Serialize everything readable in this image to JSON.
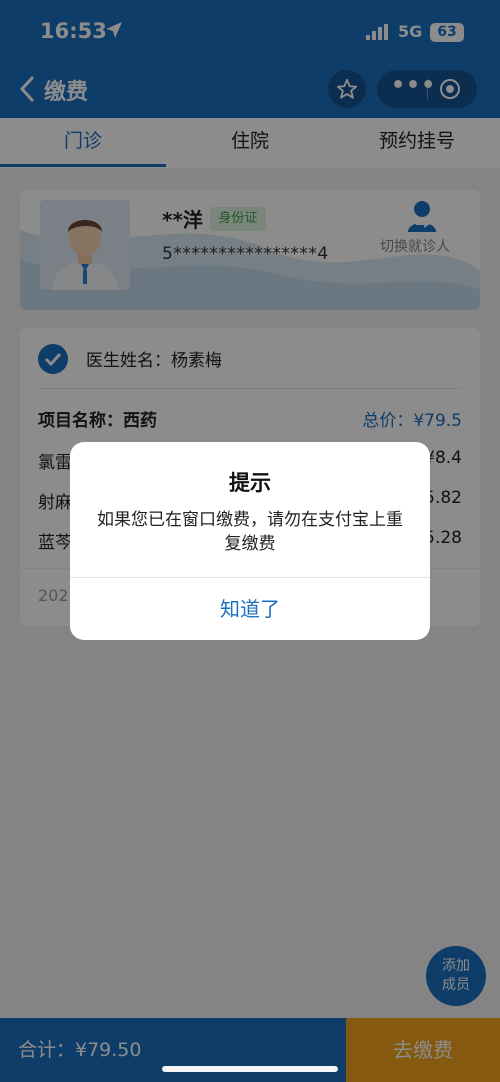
{
  "status_bar": {
    "time": "16:53",
    "network": "5G",
    "battery": "63"
  },
  "nav": {
    "title": "缴费"
  },
  "tabs": [
    {
      "label": "门诊",
      "active": true
    },
    {
      "label": "住院",
      "active": false
    },
    {
      "label": "预约挂号",
      "active": false
    }
  ],
  "patient": {
    "name": "**洋",
    "id_type": "身份证",
    "id_number": "5****************4",
    "switch_label": "切换就诊人"
  },
  "order": {
    "doctor": "医生姓名：杨素梅",
    "item_name": "项目名称：西药",
    "total": "总价：¥79.5",
    "drugs": [
      {
        "name": "氯雷",
        "price": "¥8.4"
      },
      {
        "name": "射麻",
        "price": "5.82"
      },
      {
        "name": "蓝芩",
        "price": "5.28"
      }
    ],
    "date": "202"
  },
  "add_member": {
    "line1": "添加",
    "line2": "成员"
  },
  "bottom": {
    "total": "合计：¥79.50",
    "pay_button": "去缴费"
  },
  "dialog": {
    "title": "提示",
    "message": "如果您已在窗口缴费，请勿在支付宝上重复缴费",
    "confirm": "知道了"
  },
  "colors": {
    "primary": "#1b6fc0",
    "pay": "#f2a21c",
    "badge_green": "#3ea04a"
  }
}
